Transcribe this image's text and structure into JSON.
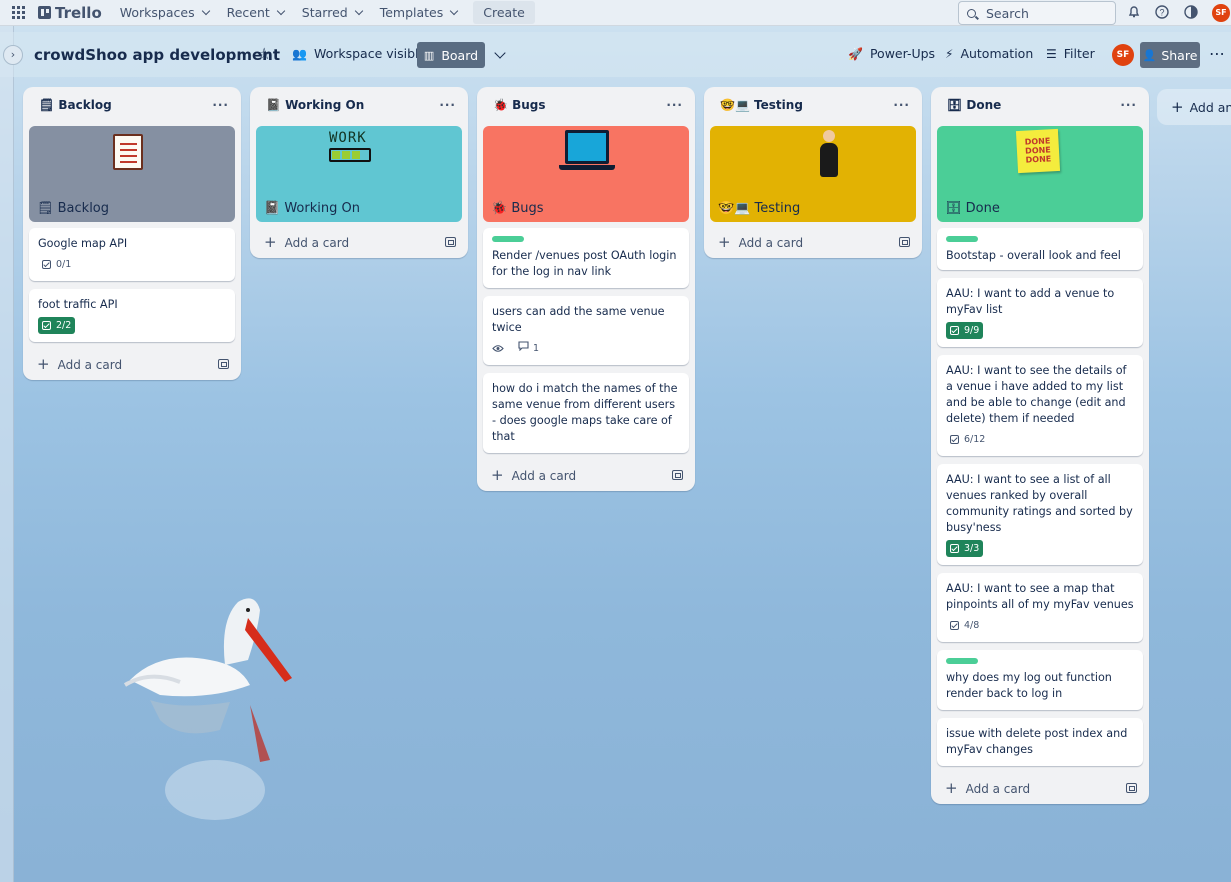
{
  "topnav": {
    "logo": "Trello",
    "menus": [
      "Workspaces",
      "Recent",
      "Starred",
      "Templates"
    ],
    "create": "Create",
    "search_placeholder": "Search",
    "avatar_initials": "SF"
  },
  "board": {
    "title": "crowdShoo app development",
    "visibility": "Workspace visible",
    "view": "Board",
    "power_ups": "Power-Ups",
    "automation": "Automation",
    "filter": "Filter",
    "avatar_initials": "SF",
    "share": "Share",
    "add_list": "Add ano"
  },
  "lists": [
    {
      "title": "🗒 Backlog",
      "cover_label": "🗒 Backlog",
      "cover_color": "#8590a2",
      "cards": [
        {
          "text": "Google map API",
          "checklist": "0/1",
          "complete": false
        },
        {
          "text": "foot traffic API",
          "checklist": "2/2",
          "complete": true
        }
      ],
      "add_card": "Add a card"
    },
    {
      "title": "📓 Working On",
      "cover_label": "📓 Working On",
      "cover_color": "#60c6d2",
      "cover_art_text": "WORK",
      "add_card": "Add a card"
    },
    {
      "title": "🐞 Bugs",
      "cover_label": "🐞 Bugs",
      "cover_color": "#f87462",
      "cards": [
        {
          "text": "Render /venues post OAuth login for the log in nav link",
          "label_color": "#4bce97"
        },
        {
          "text": "users can add the same venue twice",
          "comments": "1"
        },
        {
          "text": "how do i match the names of the same venue from different users - does google maps take care of that"
        }
      ],
      "add_card": "Add a card"
    },
    {
      "title": "🤓💻 Testing",
      "cover_label": "🤓💻 Testing",
      "cover_color": "#e2b203",
      "add_card": "Add a card"
    },
    {
      "title": "🗄 Done",
      "cover_label": "🗄 Done",
      "cover_color": "#4bce97",
      "cover_art_text": "DONE DONE DONE",
      "cards": [
        {
          "text": "Bootstap - overall look and feel",
          "label_color": "#4bce97"
        },
        {
          "text": "AAU: I want to add a venue to myFav list",
          "checklist": "9/9",
          "complete": true
        },
        {
          "text": "AAU: I want to see the details of a venue i have added to my list and be able to change (edit and delete) them if needed",
          "checklist": "6/12",
          "complete": false
        },
        {
          "text": "AAU: I want to see a list of all venues ranked by overall community ratings and sorted by busy'ness",
          "checklist": "3/3",
          "complete": true
        },
        {
          "text": "AAU: I want to see a map that pinpoints all of my myFav venues",
          "checklist": "4/8",
          "complete": false
        },
        {
          "text": "why does my log out function render back to log in",
          "label_color": "#4bce97"
        },
        {
          "text": "issue with delete post index and myFav changes"
        }
      ],
      "add_card": "Add a card"
    }
  ]
}
